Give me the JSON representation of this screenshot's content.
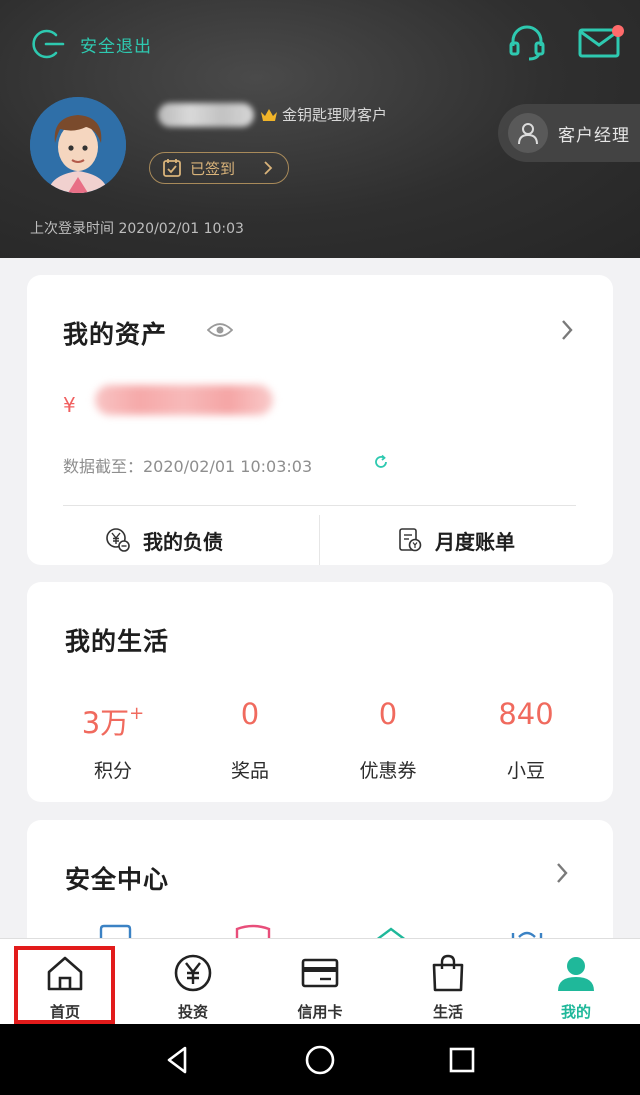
{
  "header": {
    "logout_label": "安全退出",
    "customer_tier": "金钥匙理财客户",
    "signin_label": "已签到",
    "manager_label": "客户经理",
    "last_login": "上次登录时间 2020/02/01 10:03"
  },
  "assets": {
    "title": "我的资产",
    "currency_symbol": "¥",
    "as_of": "数据截至：2020/02/01 10:03:03",
    "debt_label": "我的负债",
    "bill_label": "月度账单"
  },
  "life": {
    "title": "我的生活",
    "stats": [
      {
        "value": "3万",
        "sup": "+",
        "label": "积分"
      },
      {
        "value": "0",
        "sup": "",
        "label": "奖品"
      },
      {
        "value": "0",
        "sup": "",
        "label": "优惠券"
      },
      {
        "value": "840",
        "sup": "",
        "label": "小豆"
      }
    ]
  },
  "security": {
    "title": "安全中心"
  },
  "tabs": [
    {
      "label": "首页",
      "icon": "home-icon"
    },
    {
      "label": "投资",
      "icon": "yen-circle-icon"
    },
    {
      "label": "信用卡",
      "icon": "credit-card-icon"
    },
    {
      "label": "生活",
      "icon": "shopping-bag-icon"
    },
    {
      "label": "我的",
      "icon": "person-icon"
    }
  ],
  "colors": {
    "accent": "#1fb89a",
    "value_red": "#f06a5e",
    "highlight": "#e21b1b"
  }
}
